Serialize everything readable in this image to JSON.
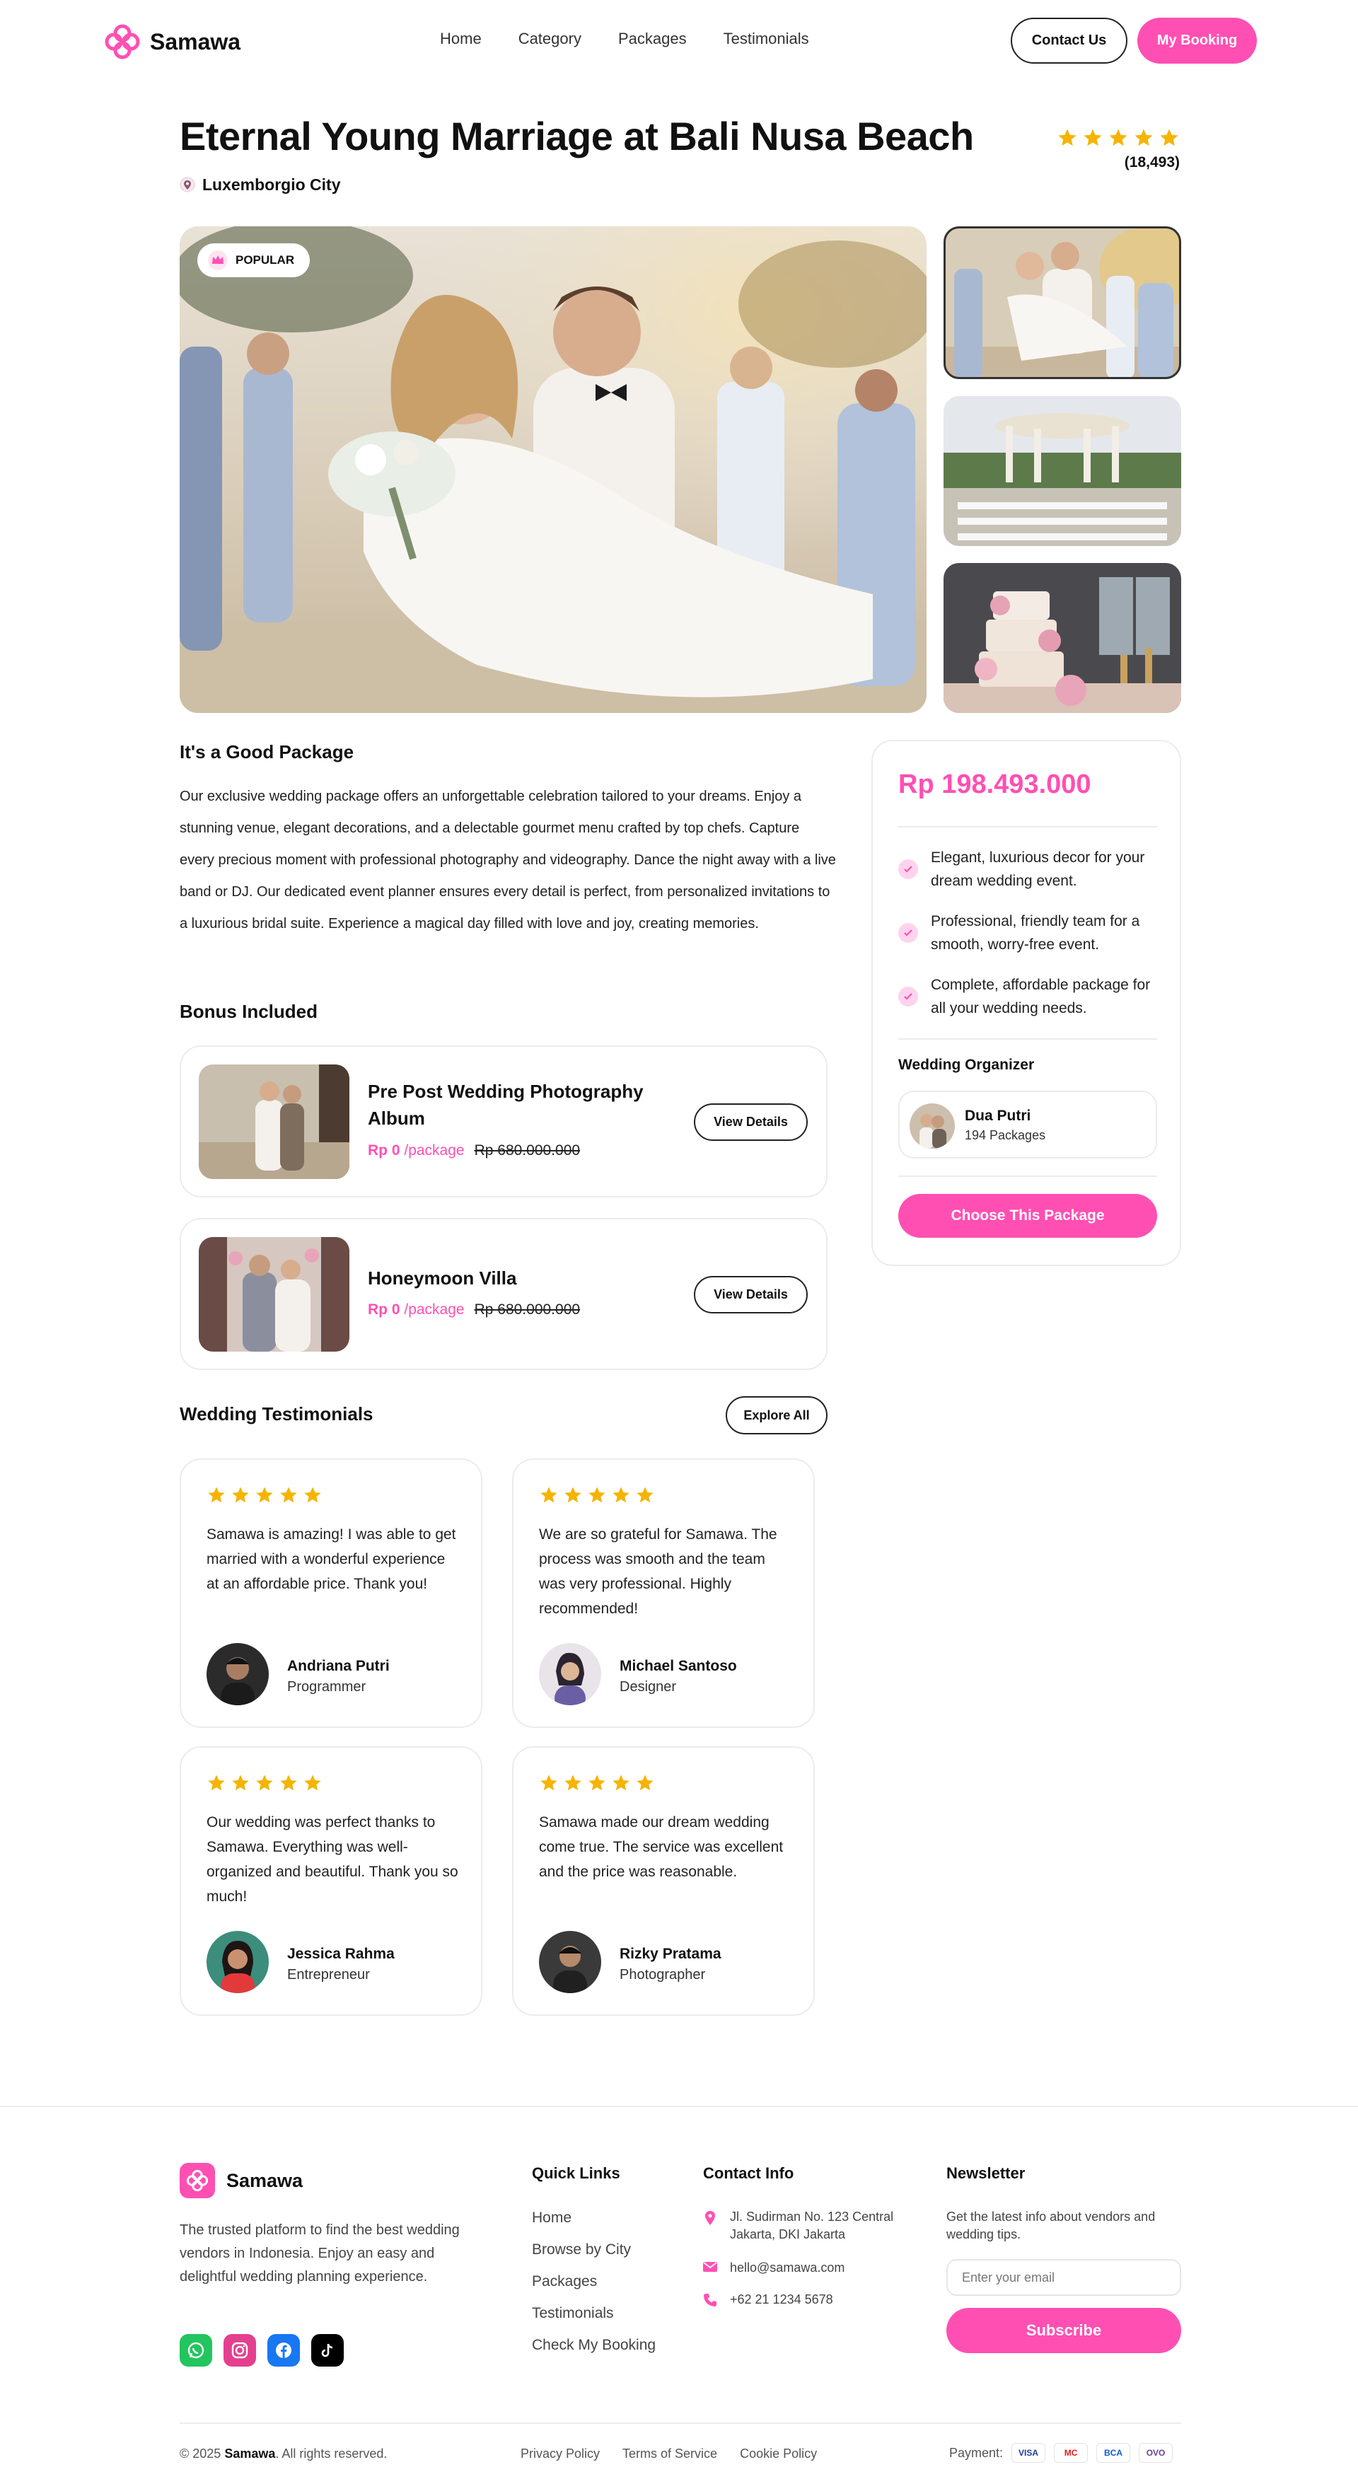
{
  "brand": {
    "name": "Samawa",
    "accent": "#ff4fb3"
  },
  "nav": {
    "items": [
      "Home",
      "Category",
      "Packages",
      "Testimonials"
    ]
  },
  "header": {
    "contact_label": "Contact Us",
    "booking_label": "My Booking"
  },
  "package": {
    "title": "Eternal Young Marriage at Bali Nusa Beach",
    "location": "Luxemborgio City",
    "rating_stars": 5,
    "rating_count": "(18,493)",
    "badge": "POPULAR"
  },
  "description": {
    "heading": "It's a Good Package",
    "text": "Our exclusive wedding package offers an unforgettable celebration tailored to your dreams. Enjoy a stunning venue, elegant decorations, and a delectable gourmet menu crafted by top chefs. Capture every precious moment with professional photography and videography. Dance the night away with a live band or DJ. Our dedicated event planner ensures every detail is perfect, from personalized invitations to a luxurious bridal suite. Experience a magical day filled with love and joy, creating memories."
  },
  "bonus": {
    "heading": "Bonus Included",
    "items": [
      {
        "title": "Pre Post Wedding Photography Album",
        "price": "Rp 0",
        "unit": "/package",
        "old_price": "Rp 680.000.000",
        "button": "View Details"
      },
      {
        "title": "Honeymoon Villa",
        "price": "Rp 0",
        "unit": "/package",
        "old_price": "Rp 680.000.000",
        "button": "View Details"
      }
    ]
  },
  "pricing": {
    "price": "Rp 198.493.000",
    "features": [
      "Elegant, luxurious decor for your dream wedding event.",
      "Professional, friendly team for a smooth, worry-free event.",
      "Complete, affordable package for all your wedding needs."
    ],
    "organizer_label": "Wedding Organizer",
    "organizer_name": "Dua Putri",
    "organizer_packages": "194 Packages",
    "cta": "Choose This Package"
  },
  "testimonials": {
    "heading": "Wedding Testimonials",
    "explore_label": "Explore All",
    "items": [
      {
        "stars": 5,
        "text": "Samawa is amazing! I was able to get married with a wonderful experience at an affordable price. Thank you!",
        "name": "Andriana Putri",
        "role": "Programmer"
      },
      {
        "stars": 5,
        "text": "We are so grateful for Samawa. The process was smooth and the team was very professional. Highly recommended!",
        "name": "Michael Santoso",
        "role": "Designer"
      },
      {
        "stars": 5,
        "text": "Our wedding was perfect thanks to Samawa. Everything was well-organized and beautiful. Thank you so much!",
        "name": "Jessica Rahma",
        "role": "Entrepreneur"
      },
      {
        "stars": 5,
        "text": "Samawa made our dream wedding come true. The service was excellent and the price was reasonable.",
        "name": "Rizky Pratama",
        "role": "Photographer"
      }
    ]
  },
  "footer": {
    "brand": "Samawa",
    "about": "The trusted platform to find the best wedding vendors in Indonesia. Enjoy an easy and delightful wedding planning experience.",
    "quick_links_heading": "Quick Links",
    "quick_links": [
      "Home",
      "Browse by City",
      "Packages",
      "Testimonials",
      "Check My Booking"
    ],
    "contact_heading": "Contact Info",
    "address": "Jl. Sudirman No. 123 Central Jakarta, DKI Jakarta",
    "email": "hello@samawa.com",
    "phone": "+62 21 1234 5678",
    "newsletter_heading": "Newsletter",
    "newsletter_text": "Get the latest info about vendors and wedding tips.",
    "newsletter_placeholder": "Enter your email",
    "subscribe_label": "Subscribe",
    "copyright_prefix": "© 2025",
    "copyright_brand": "Samawa",
    "copyright_suffix": ". All rights reserved.",
    "legal": [
      "Privacy Policy",
      "Terms of Service",
      "Cookie Policy"
    ],
    "payment_label": "Payment:",
    "payment_methods": [
      "VISA",
      "MC",
      "BCA",
      "OVO"
    ]
  },
  "colors": {
    "star": "#f5b400",
    "text": "#111111",
    "border": "#ececec"
  }
}
